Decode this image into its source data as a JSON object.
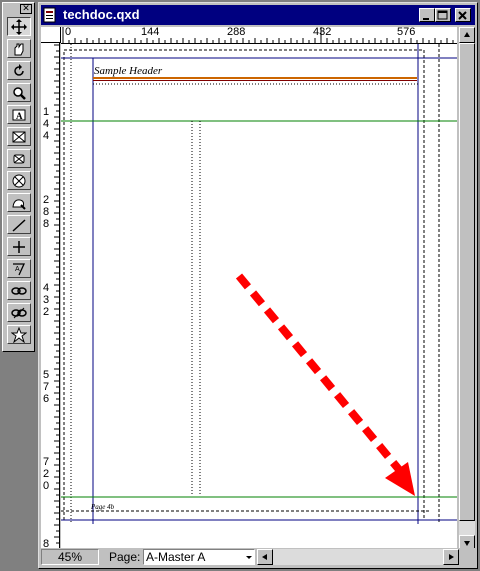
{
  "window": {
    "title": "techdoc.qxd"
  },
  "palette": {
    "close_glyph": "✕",
    "tools": [
      {
        "icon": "move-icon"
      },
      {
        "icon": "hand-icon"
      },
      {
        "icon": "rotate-icon"
      },
      {
        "icon": "zoom-icon"
      },
      {
        "icon": "text-box-icon"
      },
      {
        "icon": "rectangle-picture-box-icon"
      },
      {
        "icon": "rect-x-picture-box-icon"
      },
      {
        "icon": "oval-picture-box-icon"
      },
      {
        "icon": "bezier-picture-box-icon"
      },
      {
        "icon": "line-tool-icon"
      },
      {
        "icon": "orthogonal-line-icon"
      },
      {
        "icon": "text-path-icon"
      },
      {
        "icon": "link-tool-icon"
      },
      {
        "icon": "unlink-tool-icon"
      },
      {
        "icon": "star-tool-icon"
      }
    ]
  },
  "rulers": {
    "top_labels": [
      "0",
      "144",
      "288",
      "432",
      "576"
    ],
    "left_labels": [
      "1",
      "4",
      "4",
      "2",
      "8",
      "8",
      "4",
      "3",
      "2",
      "5",
      "7",
      "6",
      "7",
      "2",
      "0",
      "8"
    ]
  },
  "document": {
    "header_text": "Sample Header",
    "footer_text": "Page 4b",
    "accent_line_colors": [
      "#cc6600",
      "#800000"
    ],
    "guide_color": "#008000",
    "margin_color": "#000080",
    "annotation_arrow_color": "#ff0000"
  },
  "statusbar": {
    "zoom": "45%",
    "page_label": "Page:",
    "page_value": "A-Master A"
  }
}
